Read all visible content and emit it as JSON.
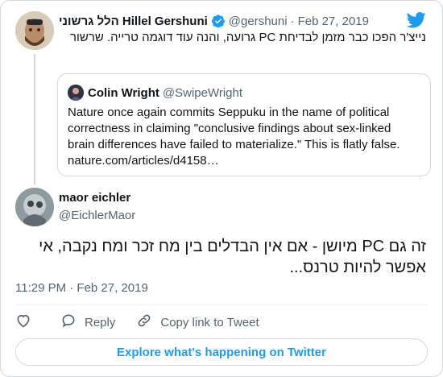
{
  "parent_tweet": {
    "display_name": "הלל גרשוני Hillel Gershuni",
    "handle": "@gershuni",
    "separator": "·",
    "date": "Feb 27, 2019",
    "text": "נייצ'ר הפכו כבר מזמן לבדיחת PC גרועה, והנה עוד דוגמה טרייה. שרשור"
  },
  "quoted_tweet": {
    "display_name": "Colin Wright",
    "handle": "@SwipeWright",
    "text": "Nature once again commits Seppuku in the name of political correctness in claiming \"conclusive findings about sex-linked brain differences have failed to materialize.\" This is flatly false. nature.com/articles/d4158…"
  },
  "main_tweet": {
    "display_name": "maor eichler",
    "handle": "@EichlerMaor",
    "text": "זה גם PC מיושן - אם אין הבדלים בין מח זכר ומח נקבה, אי אפשר להיות טרנס...",
    "timestamp": "11:29 PM · Feb 27, 2019"
  },
  "actions": {
    "reply_label": "Reply",
    "copy_link_label": "Copy link to Tweet"
  },
  "explore_label": "Explore what's happening on Twitter",
  "icons": {
    "verified": "verified-badge-icon",
    "logo": "twitter-bird-icon",
    "like": "heart-icon",
    "reply": "speech-bubble-icon",
    "copy_link": "link-icon"
  },
  "colors": {
    "accent": "#1d9bf0",
    "secondary_text": "#536471",
    "border": "#cfd9de"
  }
}
